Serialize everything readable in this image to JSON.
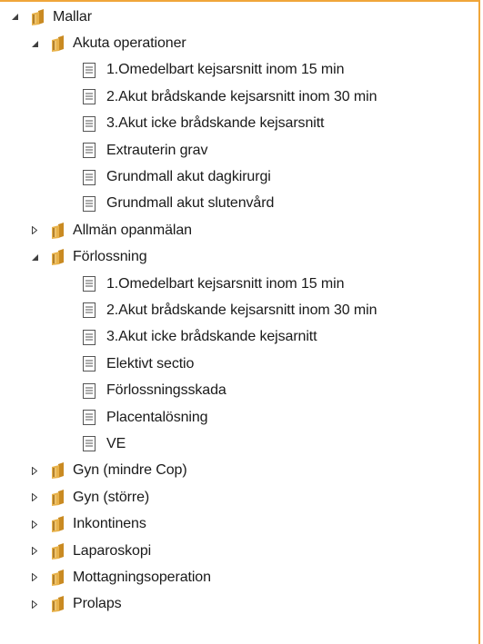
{
  "tree": {
    "root": {
      "label": "Mallar",
      "expanded": true,
      "icon": "folder-icon",
      "children": [
        {
          "label": "Akuta operationer",
          "expanded": true,
          "icon": "folder-icon",
          "children": [
            {
              "label": "1.Omedelbart kejsarsnitt inom 15 min",
              "icon": "document-icon"
            },
            {
              "label": "2.Akut brådskande kejsarsnitt inom 30 min",
              "icon": "document-icon"
            },
            {
              "label": "3.Akut icke brådskande kejsarsnitt",
              "icon": "document-icon"
            },
            {
              "label": "Extrauterin grav",
              "icon": "document-icon"
            },
            {
              "label": "Grundmall akut dagkirurgi",
              "icon": "document-icon"
            },
            {
              "label": "Grundmall akut slutenvård",
              "icon": "document-icon"
            }
          ]
        },
        {
          "label": "Allmän opanmälan",
          "expanded": false,
          "icon": "folder-icon"
        },
        {
          "label": "Förlossning",
          "expanded": true,
          "icon": "folder-icon",
          "children": [
            {
              "label": "1.Omedelbart kejsarsnitt inom 15 min",
              "icon": "document-icon"
            },
            {
              "label": "2.Akut brådskande kejsarsnitt inom 30 min",
              "icon": "document-icon"
            },
            {
              "label": "3.Akut icke brådskande kejsarnitt",
              "icon": "document-icon"
            },
            {
              "label": "Elektivt sectio",
              "icon": "document-icon"
            },
            {
              "label": "Förlossningsskada",
              "icon": "document-icon"
            },
            {
              "label": "Placentalösning",
              "icon": "document-icon"
            },
            {
              "label": "VE",
              "icon": "document-icon"
            }
          ]
        },
        {
          "label": "Gyn (mindre Cop)",
          "expanded": false,
          "icon": "folder-icon"
        },
        {
          "label": "Gyn (större)",
          "expanded": false,
          "icon": "folder-icon"
        },
        {
          "label": "Inkontinens",
          "expanded": false,
          "icon": "folder-icon"
        },
        {
          "label": "Laparoskopi",
          "expanded": false,
          "icon": "folder-icon"
        },
        {
          "label": "Mottagningsoperation",
          "expanded": false,
          "icon": "folder-icon"
        },
        {
          "label": "Prolaps",
          "expanded": false,
          "icon": "folder-icon"
        }
      ]
    }
  },
  "colors": {
    "frame_border": "#f0a63a",
    "folder_front": "#e8b24a",
    "folder_back": "#c98a22",
    "folder_stripe": "#7a4f12",
    "arrow": "#404040",
    "document_outline": "#555555"
  }
}
